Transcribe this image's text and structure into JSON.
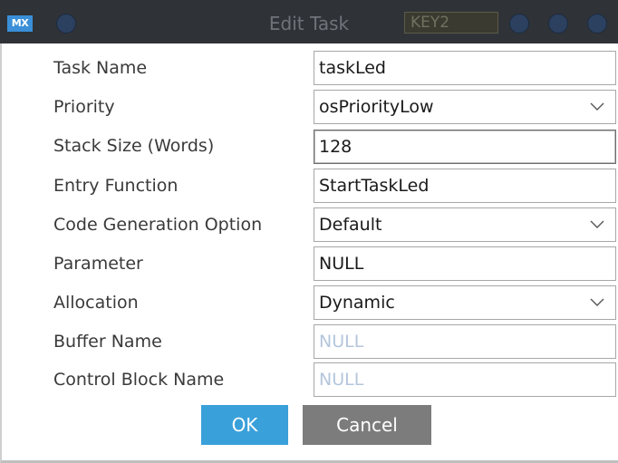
{
  "window": {
    "app_icon_label": "MX",
    "title": "Edit Task",
    "background_label": "KEY2"
  },
  "form": {
    "task_name": {
      "label": "Task Name",
      "value": "taskLed"
    },
    "priority": {
      "label": "Priority",
      "value": "osPriorityLow"
    },
    "stack_size": {
      "label": "Stack Size (Words)",
      "value": "128"
    },
    "entry_function": {
      "label": "Entry Function",
      "value": "StartTaskLed"
    },
    "code_generation": {
      "label": "Code Generation Option",
      "value": "Default"
    },
    "parameter": {
      "label": "Parameter",
      "value": "NULL"
    },
    "allocation": {
      "label": "Allocation",
      "value": "Dynamic"
    },
    "buffer_name": {
      "label": "Buffer Name",
      "placeholder": "NULL"
    },
    "control_block_name": {
      "label": "Control Block Name",
      "placeholder": "NULL"
    }
  },
  "buttons": {
    "ok_label": "OK",
    "cancel_label": "Cancel"
  },
  "icons": {
    "dropdown": "chevron-down-icon",
    "app": "mx-logo-icon"
  },
  "colors": {
    "titlebar": "#2f3338",
    "ok_button": "#3aa0da",
    "cancel_button": "#7c7c7c",
    "placeholder_text": "#b4c6dc"
  }
}
